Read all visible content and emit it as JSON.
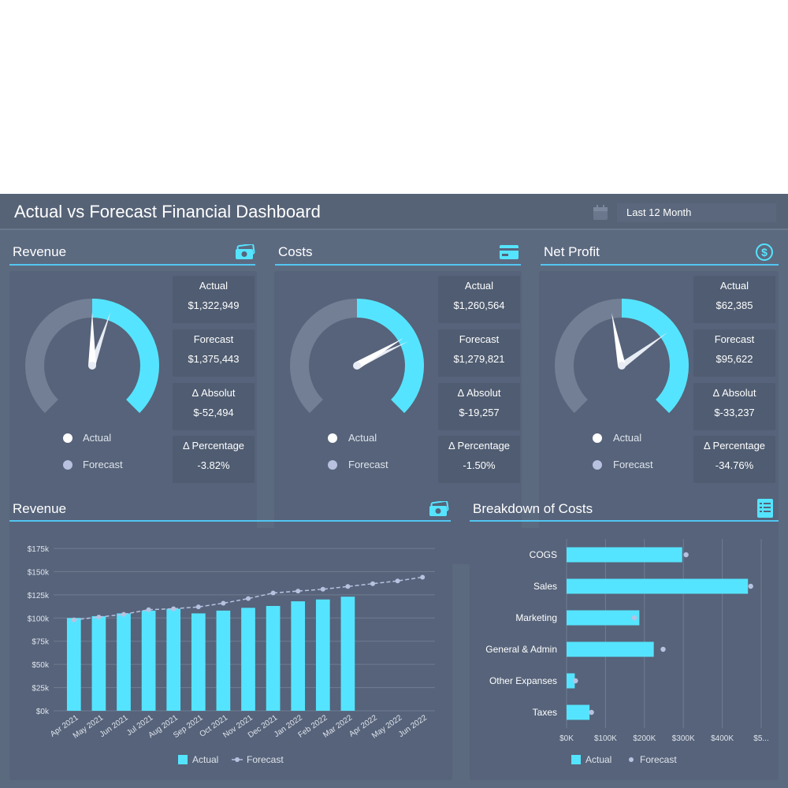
{
  "dashboard": {
    "title": "Actual vs Forecast Financial Dashboard",
    "date_range": "Last 12 Month"
  },
  "colors": {
    "actual": "#55e4ff",
    "forecast": "#b8c2e0",
    "gauge_track": "#737f94",
    "accent_line": "#52c6f2"
  },
  "kpis": [
    {
      "title": "Revenue",
      "icon": "cash-icon",
      "actual_label": "Actual",
      "actual": "$1,322,949",
      "forecast_label": "Forecast",
      "forecast": "$1,375,443",
      "abs_label": "Δ Absolut",
      "abs": "$-52,494",
      "pct_label": "Δ Percentage",
      "pct": "-3.82%",
      "gauge_actual": 0.5,
      "gauge_forecast": 0.57
    },
    {
      "title": "Costs",
      "icon": "credit-card-icon",
      "actual_label": "Actual",
      "actual": "$1,260,564",
      "forecast_label": "Forecast",
      "forecast": "$1,279,821",
      "abs_label": "Δ Absolut",
      "abs": "$-19,257",
      "pct_label": "Δ Percentage",
      "pct": "-1.50%",
      "gauge_actual": 0.72,
      "gauge_forecast": 0.74
    },
    {
      "title": "Net Profit",
      "icon": "dollar-circle-icon",
      "actual_label": "Actual",
      "actual": "$62,385",
      "forecast_label": "Forecast",
      "forecast": "$95,622",
      "abs_label": "Δ Absolut",
      "abs": "$-33,237",
      "pct_label": "Δ Percentage",
      "pct": "-34.76%",
      "gauge_actual": 0.46,
      "gauge_forecast": 0.7
    }
  ],
  "gauge_legend": {
    "actual": "Actual",
    "forecast": "Forecast"
  },
  "revenue_chart_title": "Revenue",
  "costs_chart_title": "Breakdown of Costs",
  "chart_data": [
    {
      "type": "bar",
      "title": "Revenue",
      "categories": [
        "Apr 2021",
        "May 2021",
        "Jun 2021",
        "Jul 2021",
        "Aug 2021",
        "Sep 2021",
        "Oct 2021",
        "Nov 2021",
        "Dec 2021",
        "Jan 2022",
        "Feb 2022",
        "Mar 2022",
        "Apr 2022",
        "May 2022",
        "Jun 2022"
      ],
      "series": [
        {
          "name": "Actual",
          "kind": "bar",
          "values": [
            100,
            102,
            105,
            108,
            110,
            105,
            108,
            111,
            113,
            118,
            120,
            123,
            null,
            null,
            null
          ]
        },
        {
          "name": "Forecast",
          "kind": "line",
          "values": [
            98,
            101,
            104,
            109,
            110,
            112,
            116,
            121,
            127,
            129,
            131,
            134,
            137,
            140,
            144
          ]
        }
      ],
      "y_ticks": [
        "$0k",
        "$25k",
        "$50k",
        "$75k",
        "$100k",
        "$125k",
        "$150k",
        "$175k"
      ],
      "ylim": [
        0,
        175
      ],
      "grid": true,
      "legend": "bottom"
    },
    {
      "type": "bar",
      "orientation": "horizontal",
      "title": "Breakdown of Costs",
      "categories": [
        "COGS",
        "Sales",
        "Marketing",
        "General & Admin",
        "Other Expanses",
        "Taxes"
      ],
      "series": [
        {
          "name": "Actual",
          "kind": "bar",
          "values": [
            297,
            466,
            187,
            224,
            21,
            59
          ]
        },
        {
          "name": "Forecast",
          "kind": "point",
          "values": [
            307,
            473,
            174,
            248,
            23,
            64
          ]
        }
      ],
      "x_ticks": [
        "$0K",
        "$100K",
        "$200K",
        "$300K",
        "$400K",
        "$5..."
      ],
      "xlim": [
        0,
        500
      ],
      "grid": true,
      "legend": "bottom"
    }
  ]
}
